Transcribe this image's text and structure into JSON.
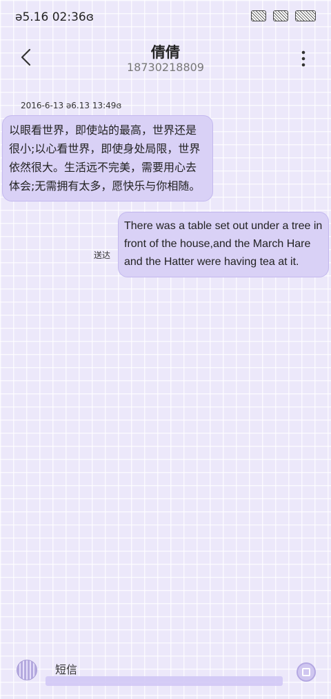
{
  "statusbar": {
    "time": "ə5.16  02:36ɞ",
    "icons": [
      "signal-icon",
      "wifi-icon",
      "battery-icon"
    ]
  },
  "header": {
    "contact_name": "倩倩",
    "phone_number": "18730218809",
    "back_icon": "chevron-left-icon",
    "more_icon": "more-vertical-icon"
  },
  "conversation": {
    "timestamp": "2016-6-13 ə6.13 13:49ɞ",
    "messages": [
      {
        "direction": "incoming",
        "text": "以眼看世界，即使站的最高，世界还是很小;以心看世界，即使身处局限，世界依然很大。生活远不完美，需要用心去体会;无需拥有太多，愿快乐与你相随。"
      },
      {
        "direction": "outgoing",
        "text": "There was a table set out under a tree in front of the house,and the March Hare and the Hatter were having tea at it.",
        "status": "送达"
      }
    ]
  },
  "composer": {
    "placeholder": "短信",
    "mic_icon": "voice-icon",
    "send_icon": "send-icon"
  },
  "colors": {
    "background": "#ece8fa",
    "bubble": "#d9d1f6",
    "bubble_border": "#c3b8ee"
  }
}
